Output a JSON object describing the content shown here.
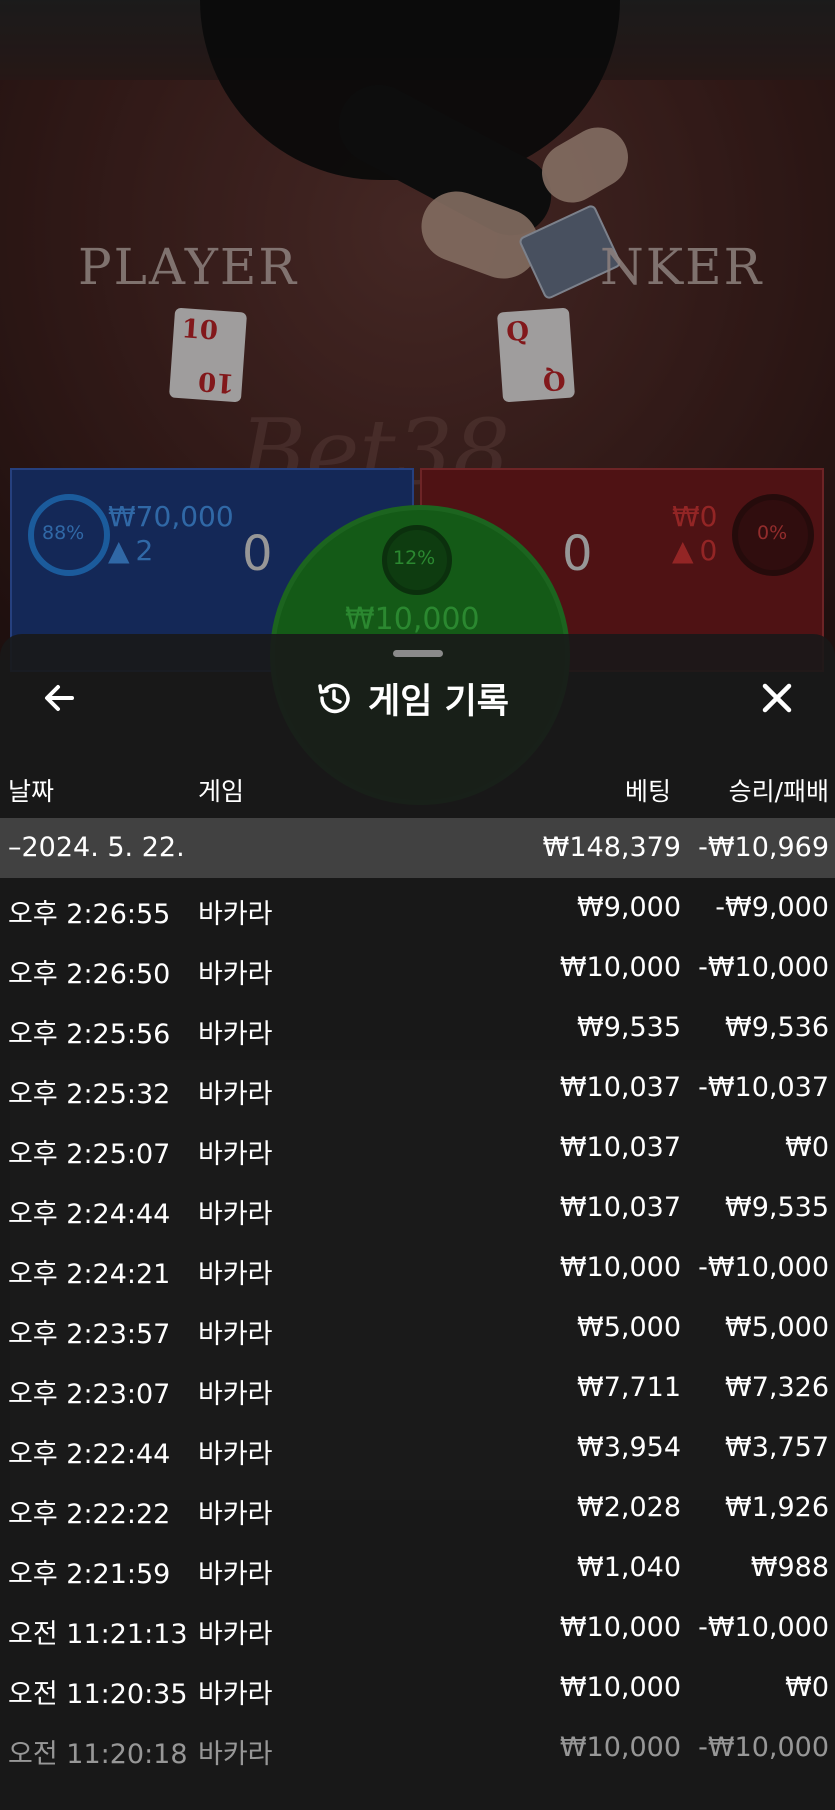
{
  "table": {
    "player_word": "PLAYER",
    "banker_word": "NKER",
    "watermark": "Bet38",
    "player_card": "10",
    "banker_card": "Q",
    "player_panel": {
      "percent": "88%",
      "amount": "₩70,000",
      "users": "2",
      "score": "0"
    },
    "banker_panel": {
      "percent": "0%",
      "amount": "₩0",
      "users": "0",
      "score": "0"
    },
    "tie_panel": {
      "percent": "12%",
      "amount": "₩10,000"
    }
  },
  "header": {
    "title": "게임 기록"
  },
  "columns": {
    "date": "날짜",
    "game": "게임",
    "bet": "베팅",
    "win_loss": "승리/패배"
  },
  "date_group": {
    "label": "–2024. 5. 22.",
    "bet": "₩148,379",
    "win_loss": "-₩10,969"
  },
  "rows": [
    {
      "time": "오후 2:26:55",
      "game": "바카라",
      "bet": "₩9,000",
      "wl": "-₩9,000"
    },
    {
      "time": "오후 2:26:50",
      "game": "바카라",
      "bet": "₩10,000",
      "wl": "-₩10,000"
    },
    {
      "time": "오후 2:25:56",
      "game": "바카라",
      "bet": "₩9,535",
      "wl": "₩9,536"
    },
    {
      "time": "오후 2:25:32",
      "game": "바카라",
      "bet": "₩10,037",
      "wl": "-₩10,037"
    },
    {
      "time": "오후 2:25:07",
      "game": "바카라",
      "bet": "₩10,037",
      "wl": "₩0"
    },
    {
      "time": "오후 2:24:44",
      "game": "바카라",
      "bet": "₩10,037",
      "wl": "₩9,535"
    },
    {
      "time": "오후 2:24:21",
      "game": "바카라",
      "bet": "₩10,000",
      "wl": "-₩10,000"
    },
    {
      "time": "오후 2:23:57",
      "game": "바카라",
      "bet": "₩5,000",
      "wl": "₩5,000"
    },
    {
      "time": "오후 2:23:07",
      "game": "바카라",
      "bet": "₩7,711",
      "wl": "₩7,326"
    },
    {
      "time": "오후 2:22:44",
      "game": "바카라",
      "bet": "₩3,954",
      "wl": "₩3,757"
    },
    {
      "time": "오후 2:22:22",
      "game": "바카라",
      "bet": "₩2,028",
      "wl": "₩1,926"
    },
    {
      "time": "오후 2:21:59",
      "game": "바카라",
      "bet": "₩1,040",
      "wl": "₩988"
    },
    {
      "time": "오전 11:21:13",
      "game": "바카라",
      "bet": "₩10,000",
      "wl": "-₩10,000"
    },
    {
      "time": "오전 11:20:35",
      "game": "바카라",
      "bet": "₩10,000",
      "wl": "₩0"
    },
    {
      "time": "오전 11:20:18",
      "game": "바카라",
      "bet": "₩10,000",
      "wl": "-₩10,000"
    }
  ]
}
